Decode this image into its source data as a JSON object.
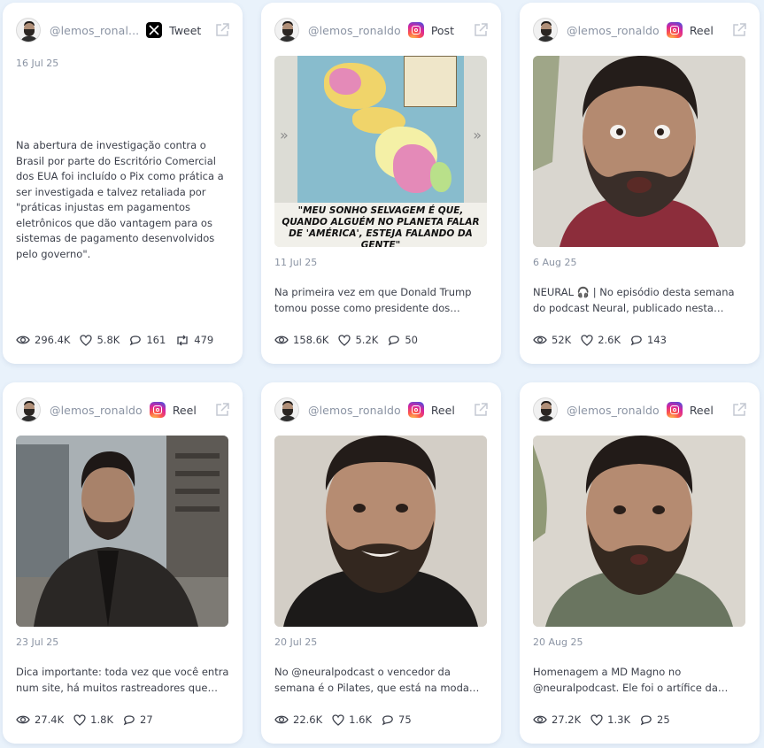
{
  "cards": [
    {
      "handle": "@lemos_ronal...",
      "platform": "x",
      "type_label": "Tweet",
      "date": "16 Jul 25",
      "text": "Na abertura de investigação contra o Brasil por parte do Escritório Comercial dos EUA foi incluído o Pix como prática a ser investigada e talvez retaliada por \"práticas injustas em pagamentos eletrônicos que dão vantagem para os sistemas de pagamento desenvolvidos pelo governo\".",
      "views": "296.4K",
      "likes": "5.8K",
      "comments": "161",
      "retweets": "479"
    },
    {
      "handle": "@lemos_ronaldo",
      "platform": "instagram",
      "type_label": "Post",
      "date": "11 Jul 25",
      "media_caption": "\"MEU SONHO SELVAGEM É QUE, QUANDO ALGUÉM NO PLANETA FALAR DE 'AMÉRICA', ESTEJA FALANDO DA GENTE\"",
      "text": "Na primeira vez em que Donald Trump tomou posse como presidente dos Estados Unidos, fui convidado para",
      "views": "158.6K",
      "likes": "5.2K",
      "comments": "50"
    },
    {
      "handle": "@lemos_ronaldo",
      "platform": "instagram",
      "type_label": "Reel",
      "date": "6 Aug 25",
      "text": "NEURAL 🎧 | No episódio desta semana do podcast Neural, publicado nesta quarta-feira",
      "views": "52K",
      "likes": "2.6K",
      "comments": "143"
    },
    {
      "handle": "@lemos_ronaldo",
      "platform": "instagram",
      "type_label": "Reel",
      "date": "23 Jul 25",
      "text": "Dica importante: toda vez que você entra num site, há muitos rastreadores que coletam seus dados",
      "views": "27.4K",
      "likes": "1.8K",
      "comments": "27"
    },
    {
      "handle": "@lemos_ronaldo",
      "platform": "instagram",
      "type_label": "Reel",
      "date": "20 Jul 25",
      "text": "No @neuralpodcast o vencedor da semana é o Pilates, que está na moda entre",
      "views": "22.6K",
      "likes": "1.6K",
      "comments": "75"
    },
    {
      "handle": "@lemos_ronaldo",
      "platform": "instagram",
      "type_label": "Reel",
      "date": "20 Aug 25",
      "text": "Homenagem a MD Magno no @neuralpodcast. Ele foi o artífice da psicanálise",
      "views": "27.2K",
      "likes": "1.3K",
      "comments": "25"
    }
  ],
  "colors": {
    "background": "#e9f2fb",
    "card": "#ffffff",
    "muted_text": "#8a93a3"
  },
  "icons": [
    "avatar",
    "x-logo-icon",
    "instagram-icon",
    "external-link-icon",
    "eye-icon",
    "heart-icon",
    "comment-icon",
    "retweet-icon"
  ]
}
